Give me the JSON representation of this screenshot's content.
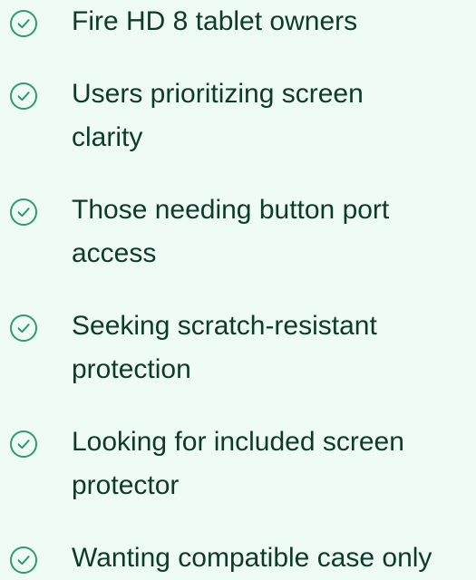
{
  "checklist": {
    "accent_color": "#2f9b68",
    "text_color": "#0c3b27",
    "background_color": "#effcf6",
    "icon": "check-circle-icon",
    "items": [
      {
        "line1": "Fire HD 8 tablet owners",
        "line2": ""
      },
      {
        "line1": "Users prioritizing screen",
        "line2": "clarity"
      },
      {
        "line1": "Those needing button port",
        "line2": "access"
      },
      {
        "line1": "Seeking scratch-resistant",
        "line2": "protection"
      },
      {
        "line1": "Looking for included screen",
        "line2": "protector"
      },
      {
        "line1": "Wanting compatible case only",
        "line2": ""
      }
    ]
  }
}
